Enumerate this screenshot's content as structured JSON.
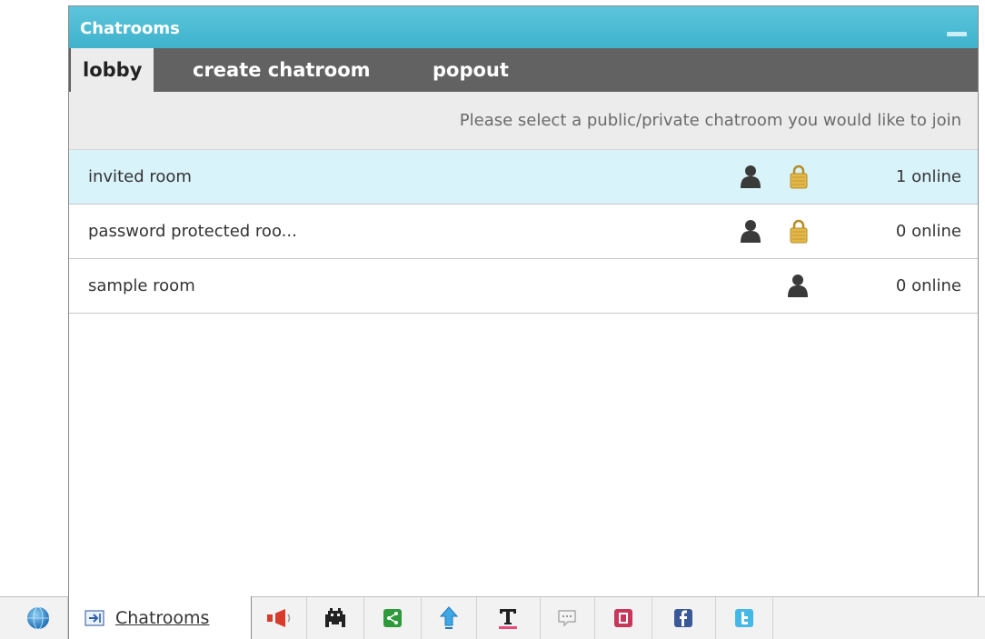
{
  "window": {
    "title": "Chatrooms",
    "tabs": [
      {
        "label": "lobby",
        "active": true
      },
      {
        "label": "create chatroom",
        "active": false
      },
      {
        "label": "popout",
        "active": false
      }
    ],
    "header_message": "Please select a public/private chatroom you would like to join",
    "rooms": [
      {
        "name": "invited room",
        "online": "1 online",
        "icons": [
          "user-icon",
          "lock-icon"
        ],
        "selected": true
      },
      {
        "name": "password protected roo...",
        "online": "0 online",
        "icons": [
          "user-icon",
          "lock-icon"
        ],
        "selected": false
      },
      {
        "name": "sample room",
        "online": "0 online",
        "icons": [
          "user-icon"
        ],
        "selected": false
      }
    ]
  },
  "taskbar": {
    "active_label": "Chatrooms",
    "icons": [
      "globe-icon",
      "announcement-icon",
      "games-icon",
      "share-icon",
      "upload-icon",
      "text-icon",
      "chat-bubble-icon",
      "bookmark-icon",
      "facebook-icon",
      "twitter-icon"
    ]
  },
  "colors": {
    "title_bar": "#4fbcd6",
    "tab_bar": "#626262",
    "selected_row": "#d9f3fb",
    "lock": "#e2b84a"
  }
}
